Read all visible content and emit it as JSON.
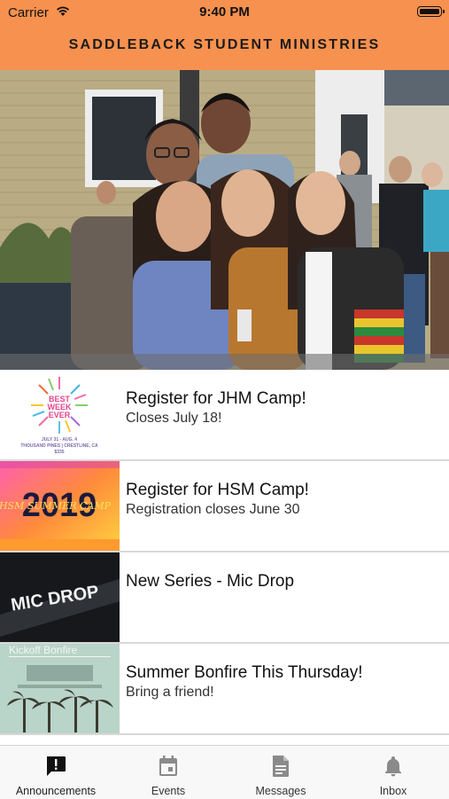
{
  "status_bar": {
    "carrier": "Carrier",
    "time": "9:40 PM"
  },
  "header": {
    "title": "SADDLEBACK STUDENT MINISTRIES",
    "background": "#f7914f"
  },
  "hero": {
    "description_icon": "group-photo"
  },
  "announcements": [
    {
      "title": "Register for JHM Camp!",
      "subtitle": "Closes July 18!",
      "thumb_lines": [
        "JULY 31 - AUG. 4",
        "THOUSAND PINES | CRESTLINE, CA",
        "$335"
      ]
    },
    {
      "title": "Register for HSM Camp!",
      "subtitle": "Registration closes June 30",
      "thumb_text": "2019",
      "thumb_subtext": "HSM SUMMER CAMP"
    },
    {
      "title": "New Series - Mic Drop",
      "subtitle": "",
      "thumb_text": "MIC DROP"
    },
    {
      "title": "Summer Bonfire This Thursday!",
      "subtitle": "Bring a friend!",
      "thumb_text": "Kickoff Bonfire"
    }
  ],
  "tabs": [
    {
      "label": "Announcements",
      "icon": "announcement-icon",
      "active": true
    },
    {
      "label": "Events",
      "icon": "calendar-icon",
      "active": false
    },
    {
      "label": "Messages",
      "icon": "document-icon",
      "active": false
    },
    {
      "label": "Inbox",
      "icon": "bell-icon",
      "active": false
    }
  ],
  "colors": {
    "accent": "#f7914f",
    "tab_active": "#111111",
    "tab_inactive": "#8a8a8a"
  }
}
